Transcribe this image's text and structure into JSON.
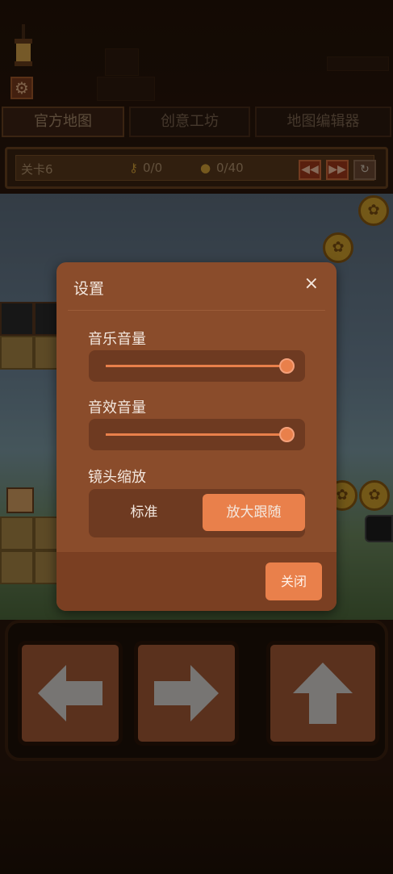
{
  "tabs": [
    {
      "label": "官方地图",
      "active": true
    },
    {
      "label": "创意工坊",
      "active": false
    },
    {
      "label": "地图编辑器",
      "active": false
    }
  ],
  "level_bar": {
    "level": "关卡6",
    "keys": "0/0",
    "coins": "0/40"
  },
  "settings": {
    "title": "设置",
    "close_icon": "×",
    "music_label": "音乐音量",
    "music_value": 1.0,
    "sfx_label": "音效音量",
    "sfx_value": 1.0,
    "zoom_label": "镜头缩放",
    "zoom_options": [
      "标准",
      "放大跟随"
    ],
    "zoom_selected": 1,
    "close_button": "关闭"
  },
  "colors": {
    "accent": "#e9804b",
    "modal_bg": "#8a4c2b",
    "slider_bg": "#6e3a21"
  },
  "icons": [
    "gear-icon",
    "key-icon",
    "coin-icon",
    "rewind-icon",
    "fast-forward-icon",
    "restart-icon",
    "left-arrow-icon",
    "right-arrow-icon",
    "up-arrow-icon"
  ]
}
